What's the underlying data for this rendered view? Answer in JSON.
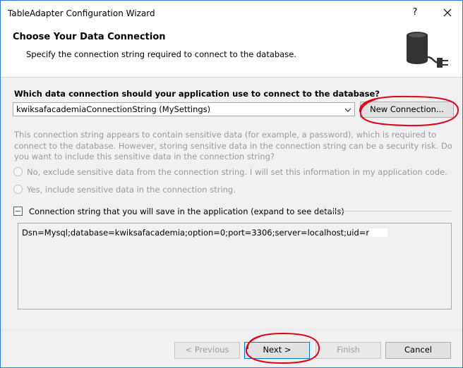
{
  "window": {
    "title": "TableAdapter Configuration Wizard",
    "help_label": "?",
    "close_icon": "close-icon"
  },
  "header": {
    "title": "Choose Your Data Connection",
    "subtitle": "Specify the connection string required to connect to the database.",
    "icon": "database-plug-icon"
  },
  "connection": {
    "question": "Which data connection should your application use to connect to the database?",
    "selected": "kwiksafacademiaConnectionString (MySettings)",
    "new_connection_label": "New Connection..."
  },
  "sensitive": {
    "note": "This connection string appears to contain sensitive data (for example, a password), which is required to connect to the database. However, storing sensitive data in the connection string can be a security risk. Do you want to include this sensitive data in the connection string?",
    "option_exclude": "No, exclude sensitive data from the connection string. I will set this information in my application code.",
    "option_include": "Yes, include sensitive data in the connection string."
  },
  "details": {
    "label": "Connection string that you will save in the application (expand to see details)",
    "connection_string": "Dsn=Mysql;database=kwiksafacademia;option=0;port=3306;server=localhost;uid=r"
  },
  "footer": {
    "previous_label": "< Previous",
    "next_label": "Next >",
    "finish_label": "Finish",
    "cancel_label": "Cancel"
  },
  "colors": {
    "accent": "#0078d7",
    "annotation": "#e0001a",
    "disabled_text": "#9a9a9a"
  }
}
